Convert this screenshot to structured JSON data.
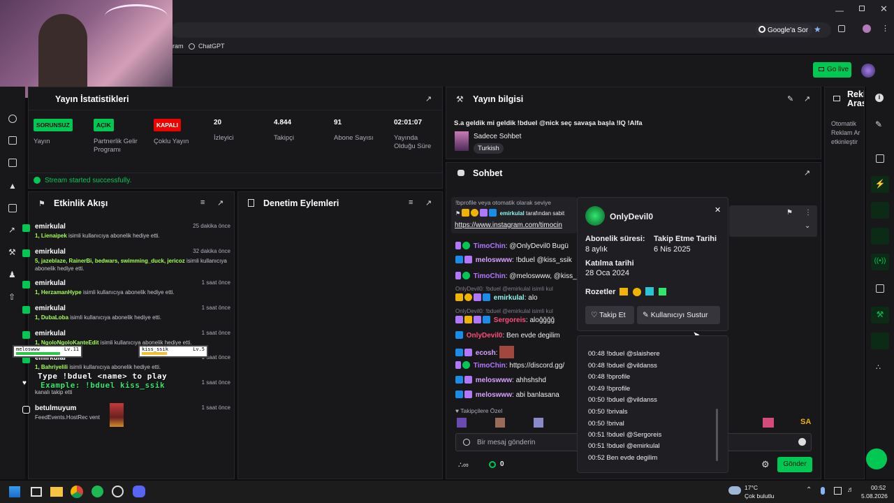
{
  "browser": {
    "google_search_label": "Google'a Sor",
    "bookmark_gram": "ram",
    "bookmark_chatgpt": "ChatGPT"
  },
  "header": {
    "go_live_label": "Go live"
  },
  "stats": {
    "title": "Yayın İstatistikleri",
    "items": [
      {
        "badge": "SORUNSUZ",
        "label": "Yayın",
        "color": "#00c853"
      },
      {
        "badge": "AÇIK",
        "label": "Partnerlik Gelir Programı",
        "color": "#00c853"
      },
      {
        "badge": "KAPALI",
        "label": "Çoklu Yayın",
        "color": "#eb0400"
      },
      {
        "value": "20",
        "label": "İzleyici"
      },
      {
        "value": "4.844",
        "label": "Takipçi"
      },
      {
        "value": "91",
        "label": "Abone Sayısı"
      },
      {
        "value": "02:01:07",
        "label": "Yayında Olduğu Süre"
      }
    ],
    "success_message": "Stream started successfully."
  },
  "activity": {
    "title": "Etkinlik Akışı",
    "items": [
      {
        "name": "emirkulal",
        "time": "25 dakika önce",
        "count": "1,",
        "users": "Lienaipek",
        "text": " isimli kullanıcıya abonelik hediye etti."
      },
      {
        "name": "emirkulal",
        "time": "32 dakika önce",
        "count": "5,",
        "users": "jazeblaze, RainerBi, bedwars, swimming_duck, jericoz",
        "text": " isimli kullanıcıya abonelik hediye etti."
      },
      {
        "name": "emirkulal",
        "time": "1 saat önce",
        "count": "1,",
        "users": "HerzamanHype",
        "text": " isimli kullanıcıya abonelik hediye etti."
      },
      {
        "name": "emirkulal",
        "time": "1 saat önce",
        "count": "1,",
        "users": "DubaLoba",
        "text": " isimli kullanıcıya abonelik hediye etti."
      },
      {
        "name": "emirkulal",
        "time": "1 saat önce",
        "count": "1,",
        "users": "NgoloNgoloKanteEdit",
        "text": " isimli kullanıcıya abonelik hediye etti."
      },
      {
        "name": "emirkulal",
        "time": "1 saat önce",
        "count": "1,",
        "users": "Bahriyelili",
        "text": " isimli kullanıcıya abonelik hediye etti."
      },
      {
        "name": "",
        "time": "1 saat önce",
        "count": "",
        "users": "",
        "text": "kanalı takip etti"
      },
      {
        "name": "betulmuyum",
        "time": "1 saat önce",
        "count": "",
        "users": "",
        "text": "FeedEvents.HostRec         vent"
      }
    ]
  },
  "moderation": {
    "title": "Denetim Eylemleri"
  },
  "stream_info": {
    "title": "Yayın bilgisi",
    "stream_title": "S.a geldik mi geldik !bduel @nick seç savaşa başla !IQ !Alfa",
    "category": "Sadece Sohbet",
    "tag": "Turkish"
  },
  "chat": {
    "title": "Sohbet",
    "pinned_prefix": "tarafından sabit",
    "pinned_by": "emirkulal",
    "pinned_text_top": "!bprofile veya otomatik olarak seviye",
    "pinned_link": "https://www.instagram.com/timocin",
    "lines": [
      {
        "user": "TimoChin",
        "color": "#b277ff",
        "text": ": @OnlyDevil0 Bugü"
      },
      {
        "user": "meloswww",
        "color": "#d9a0ff",
        "text": ": !bduel @kiss_ssik"
      },
      {
        "user": "TimoChin",
        "color": "#b277ff",
        "text": ": @meloswww, @kiss_"
      },
      {
        "reply": "OnlyDevil0: !bduel @emirkulal isimli kul",
        "user": "emirkulal",
        "color": "#8ef5f0",
        "text": ": alo"
      },
      {
        "reply": "OnlyDevil0: !bduel @emirkulal isimli kul",
        "user": "Sergoreis",
        "color": "#ff4c7a",
        "text": ": aloğğğğ"
      },
      {
        "user": "OnlyDevil0",
        "color": "#ff4c7a",
        "text": ": Ben evde degilim"
      },
      {
        "user": "ecosh",
        "color": "#d9a0ff",
        "text": ":"
      },
      {
        "user": "TimoChin",
        "color": "#b277ff",
        "text": ": https://discord.gg/"
      },
      {
        "user": "meloswww",
        "color": "#d9a0ff",
        "text": ": ahhshshd"
      },
      {
        "user": "meloswww",
        "color": "#d9a0ff",
        "text": ": abi banlasana"
      }
    ],
    "followers_only": "Takipçilere Özel",
    "input_placeholder": "Bir mesaj gönderin",
    "points": "0",
    "send_label": "Gönder"
  },
  "user_card": {
    "username": "OnlyDevil0",
    "sub_label": "Abonelik süresi:",
    "sub_value": "8 aylık",
    "follow_label": "Takip Etme Tarihi",
    "follow_value": "6 Nis 2025",
    "join_label": "Katılma tarihi",
    "join_value": "28 Oca 2024",
    "badges_label": "Rozetler",
    "follow_button": "Takip Et",
    "mute_button": "Kullanıcıyı Sustur",
    "log": [
      "00:48 !bduel @slaishere",
      "00:48 !bduel @vildanss",
      "00:48 !bprofile",
      "00:49 !bprofile",
      "00:50 !bduel @vildanss",
      "00:50 !brivals",
      "00:50 !brival",
      "00:51 !bduel @Sergoreis",
      "00:51 !bduel @emirkulal",
      "00:52 Ben evde degilim"
    ]
  },
  "ad_panel": {
    "title": "Reklam Arası",
    "text": "Otomatik Reklam Ar etkinleştir"
  },
  "overlay": {
    "player1": "meloswww",
    "player1_level": "Lv.11",
    "player2": "kiss_ssik",
    "player2_level": "Lv.5",
    "line1": "Type !bduel <name> to play",
    "line2": "Example: !bduel kiss_ssik"
  },
  "taskbar": {
    "temperature": "17°C",
    "weather": "Çok bulutlu",
    "time": "00:52",
    "date": "5.08.2026"
  },
  "colors": {
    "accent": "#00c853",
    "danger": "#eb0400",
    "panel": "#18181b"
  }
}
